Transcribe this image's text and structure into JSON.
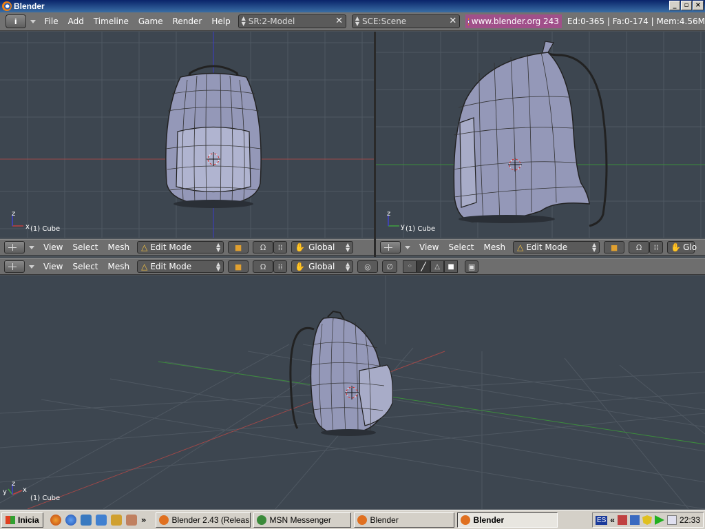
{
  "window": {
    "title": "Blender"
  },
  "top_header": {
    "editor_type": "i",
    "menus": [
      "File",
      "Add",
      "Timeline",
      "Game",
      "Render",
      "Help"
    ],
    "screen_field": "SR:2-Model",
    "scene_field": "SCE:Scene",
    "url_button": "www.blender.org 243",
    "stats": "Ed:0-365 | Fa:0-174 | Mem:4.56M"
  },
  "viewports": {
    "front": {
      "object_label": "(1) Cube"
    },
    "side": {
      "object_label": "(1) Cube"
    },
    "persp": {
      "object_label": "(1) Cube"
    }
  },
  "view_header": {
    "menus": [
      "View",
      "Select",
      "Mesh"
    ],
    "mode": "Edit Mode",
    "orientation": "Global",
    "orientation_short": "Glo"
  },
  "taskbar": {
    "start_label": "Inicia",
    "tasks": [
      {
        "label": "Blender 2.43 (Releas...",
        "color": "#e07020"
      },
      {
        "label": "MSN Messenger",
        "color": "#3a8a3a"
      },
      {
        "label": "Blender",
        "color": "#e07020"
      },
      {
        "label": "Blender",
        "color": "#e07020",
        "active": true
      }
    ],
    "language": "ES",
    "clock": "22:33"
  },
  "colors": {
    "viewport_bg": "#3d4650",
    "header_bg": "#727272",
    "grid": "#4f5862",
    "x_axis": "#b04040",
    "y_axis": "#3c8c3c",
    "z_axis": "#3c3cc8"
  }
}
